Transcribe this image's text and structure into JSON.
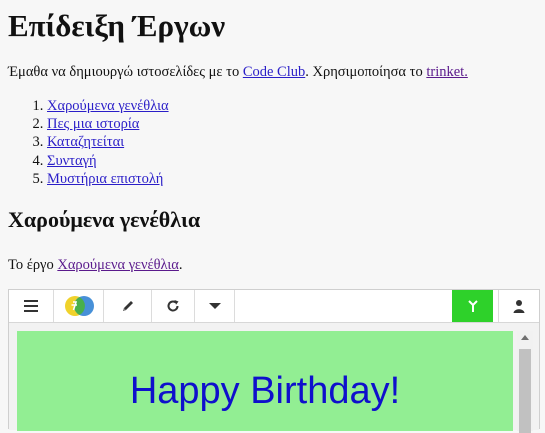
{
  "page": {
    "title": "Επίδειξη Έργων",
    "intro_prefix": "Έμαθα να δημιουργώ ιστοσελίδες με το ",
    "intro_link1": "Code Club",
    "intro_middle": ". Χρησιμοποίησα το ",
    "intro_link2": "trinket."
  },
  "projects": [
    {
      "label": "Χαρούμενα γενέθλια"
    },
    {
      "label": "Πες μια ιστορία"
    },
    {
      "label": "Καταζητείται"
    },
    {
      "label": "Συνταγή"
    },
    {
      "label": "Μυστήρια επιστολή"
    }
  ],
  "section": {
    "heading": "Χαρούμενα γενέθλια",
    "line_prefix": "Το έργο ",
    "line_link": "Χαρούμενα γενέθλια",
    "line_suffix": "."
  },
  "trinket": {
    "toolbar_icons": [
      "menu-icon",
      "trinket-logo-icon",
      "pencil-icon",
      "refresh-icon",
      "caret-down-icon",
      "run-icon",
      "user-icon"
    ],
    "run_color": "#2ed12a",
    "canvas_text": "Happy Birthday!",
    "canvas_bg": "#92ee93",
    "canvas_text_color": "#0f10cc"
  }
}
